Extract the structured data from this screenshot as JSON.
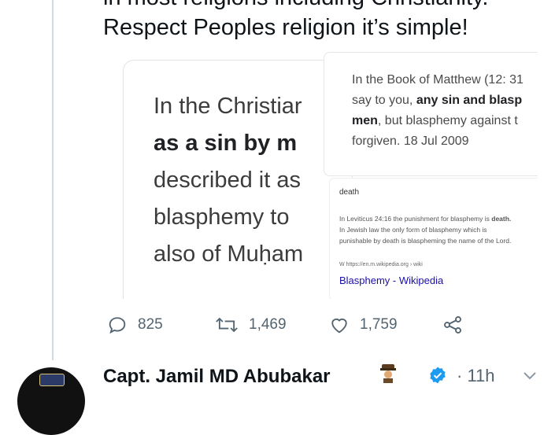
{
  "tweet": {
    "text_line1": "in most religions including Christianity.",
    "text_line2": "Respect Peoples religion it’s simple!"
  },
  "media": {
    "left_image": {
      "lines": [
        "In the Christiar",
        "as a sin by m",
        "described it as",
        "blasphemy to",
        "also of Muḥam"
      ]
    },
    "right_top_image": {
      "line1": "In the Book of Matthew (12: 31",
      "line2_a": "say to you, ",
      "line2_b": "any sin and blasp",
      "line3_a": "men",
      "line3_b": ", but blasphemy against t",
      "line4": "forgiven.  18 Jul 2009"
    },
    "right_bottom_image": {
      "heading": "death",
      "line1_a": "In Leviticus 24:16 the punishment for blasphemy is ",
      "line1_b": "death.",
      "line2": "In Jewish law the only form of blasphemy which is",
      "line3": "punishable by death is blaspheming the name of the Lord.",
      "source": "W  https://en.m.wikipedia.org › wiki",
      "link": "Blasphemy - Wikipedia"
    }
  },
  "actions": {
    "replies": "825",
    "retweets": "1,469",
    "likes": "1,759"
  },
  "next_tweet": {
    "author": "Capt. Jamil MD Abubakar",
    "time": "· 11h"
  },
  "colors": {
    "icon_gray": "#536471",
    "link_blue": "#1a0dab",
    "verified_blue": "#1d9bf0"
  }
}
